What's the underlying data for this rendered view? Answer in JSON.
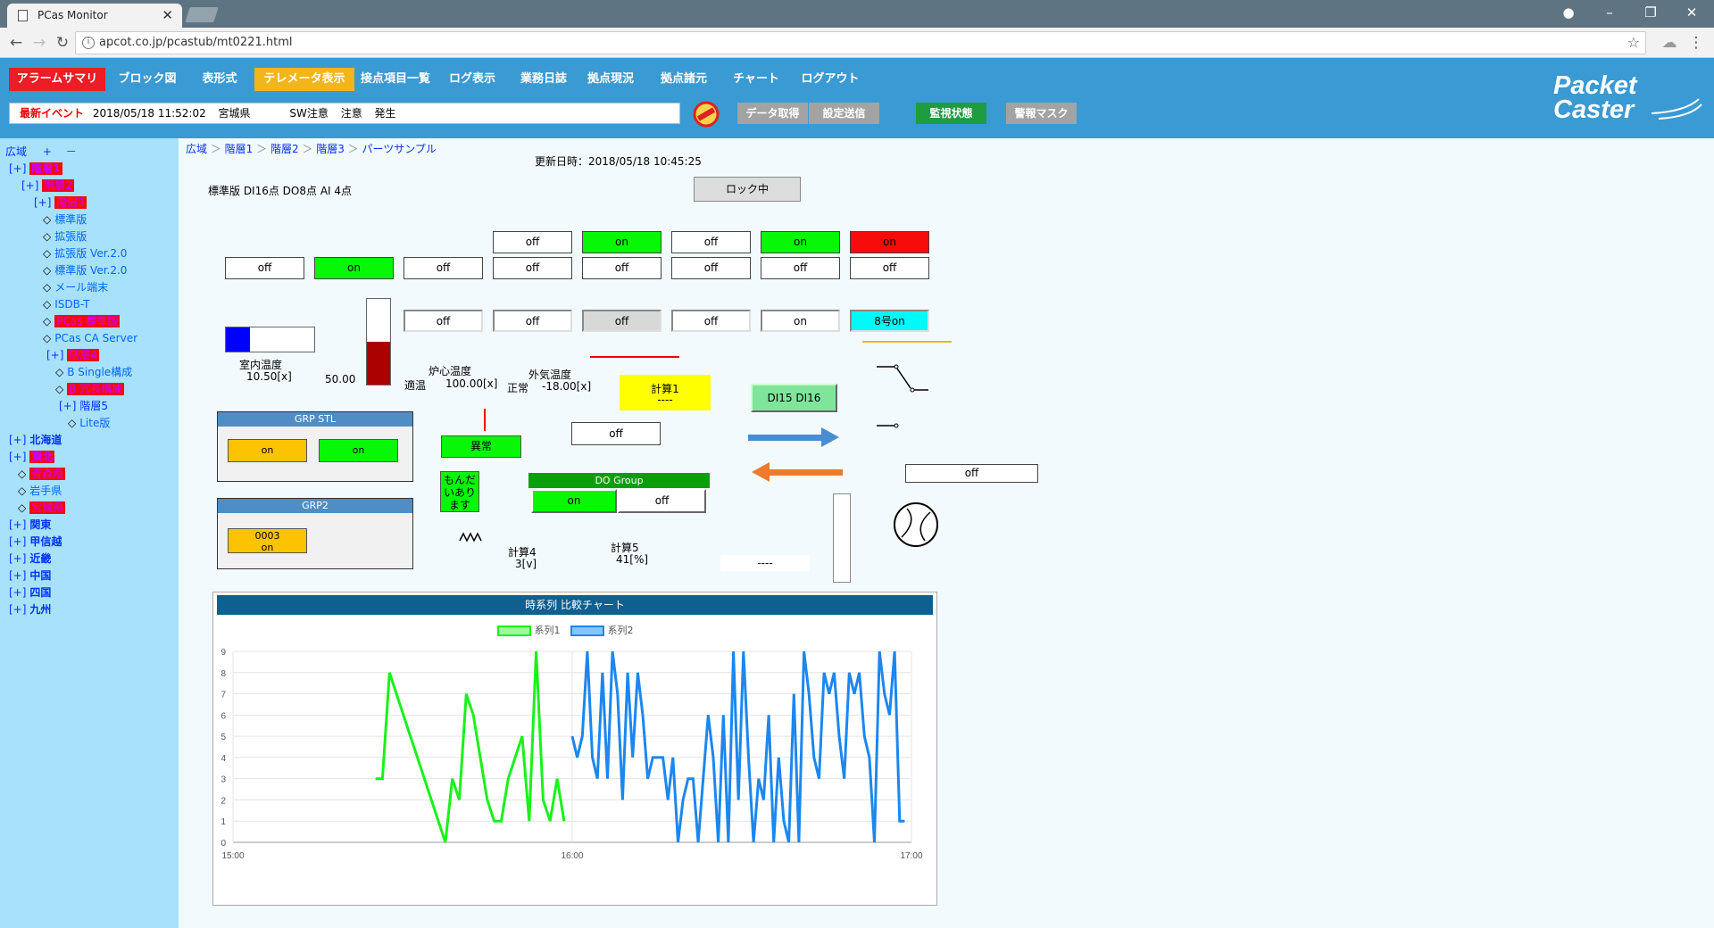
{
  "browser": {
    "tab_title": "PCas Monitor",
    "url": "apcot.co.jp/pcastub/mt0221.html"
  },
  "menu": {
    "items": [
      "アラームサマリ",
      "ブロック図",
      "表形式",
      "テレメータ表示",
      "接点項目一覧",
      "ログ表示",
      "業務日誌",
      "拠点現況",
      "拠点諸元",
      "チャート",
      "ログアウト"
    ]
  },
  "event": {
    "label": "最新イベント",
    "time": "2018/05/18 11:52:02",
    "place": "宮城県",
    "type": "SW注意",
    "level": "注意",
    "state": "発生"
  },
  "actions": [
    "データ取得",
    "設定送信",
    "監視状態",
    "警報マスク"
  ],
  "logo": {
    "line1": "Packet",
    "line2": "Caster"
  },
  "tree": {
    "root": "広域",
    "plus": "+",
    "minus": "－",
    "toggle": "[+]",
    "nodes": [
      {
        "label": "階層1",
        "highlight": true
      },
      {
        "label": "階層2",
        "highlight": true
      },
      {
        "label": "階層3",
        "highlight": true
      },
      {
        "label": "標準版"
      },
      {
        "label": "拡張版"
      },
      {
        "label": "拡張版 Ver.2.0"
      },
      {
        "label": "標準版 Ver.2.0"
      },
      {
        "label": "メール端末"
      },
      {
        "label": "ISDB-T"
      },
      {
        "label": "PCas 標準版",
        "highlight": true
      },
      {
        "label": "PCas CA Server"
      },
      {
        "label": "階層4",
        "highlight": true
      },
      {
        "label": "B Single構成"
      },
      {
        "label": "B 冗長構成",
        "highlight": true
      },
      {
        "label": "階層5"
      },
      {
        "label": "Lite版"
      },
      {
        "label": "北海道"
      },
      {
        "label": "東北",
        "highlight": true
      },
      {
        "label": "青森県",
        "highlight": true
      },
      {
        "label": "岩手県"
      },
      {
        "label": "宮城県",
        "highlight": true
      },
      {
        "label": "関東"
      },
      {
        "label": "甲信越"
      },
      {
        "label": "近畿"
      },
      {
        "label": "中国"
      },
      {
        "label": "四国"
      },
      {
        "label": "九州"
      }
    ]
  },
  "breadcrumb": [
    "広域",
    "階層1",
    "階層2",
    "階層3",
    "パーツサンプル"
  ],
  "updated": "更新日時：2018/05/18 10:45:25",
  "device_info": "標準版 DI16点 DO8点 AI 4点",
  "lock_button": "ロック中",
  "switches": {
    "row1": [
      "off",
      "on",
      "off",
      "on",
      "on"
    ],
    "row2": [
      "off",
      "on",
      "off",
      "off",
      "off",
      "off",
      "off",
      "off"
    ],
    "row3": [
      "off",
      "off",
      "off",
      "off",
      "on",
      "8号on"
    ]
  },
  "gauges": {
    "room_temp": {
      "label": "室内温度",
      "value": "10.50[x]",
      "fill": 0.27
    },
    "vertical": {
      "value": "50.00",
      "fill": 0.5
    },
    "core_temp": {
      "label": "炉心温度",
      "state": "適温",
      "value": "100.00[x]"
    },
    "outside_temp": {
      "label": "外気温度",
      "state": "正常",
      "value": "-18.00[x]"
    }
  },
  "calc": {
    "calc1": {
      "label": "計算1",
      "value": "----"
    },
    "calc4": {
      "label": "計算4",
      "value": "3[v]"
    },
    "calc5": {
      "label": "計算5",
      "value": "41[%]"
    },
    "dash": "----"
  },
  "di_button": "DI15 DI16",
  "grp_stl": {
    "title": "GRP STL",
    "buttons": [
      "on",
      "on"
    ]
  },
  "grp2": {
    "title": "GRP2",
    "value": "0003",
    "state": "on"
  },
  "abnormal": "異常",
  "problem": "もんだいあります",
  "do_group": {
    "title": "DO Group",
    "on": "on",
    "off": "off"
  },
  "off_single": "off",
  "off_wide": "off",
  "colors": {
    "menu_red": "#ee1c24",
    "menu_yellow": "#f2b619",
    "green": "#07f707",
    "header": "#3a9ad3"
  },
  "chart_data": {
    "type": "line",
    "title": "時系列 比較チャート",
    "x_ticks": [
      "15:00",
      "16:00",
      "17:00"
    ],
    "ylim": [
      0,
      9
    ],
    "y_ticks": [
      0,
      1,
      2,
      3,
      4,
      5,
      6,
      7,
      8,
      9
    ],
    "series": [
      {
        "name": "系列1",
        "color": "#19f219",
        "values": [
          3,
          3,
          8,
          7,
          6,
          5,
          4,
          3,
          2,
          1,
          0,
          3,
          2,
          7,
          6,
          4,
          2,
          1,
          1,
          3,
          4,
          5,
          1,
          9,
          2,
          1,
          3,
          1
        ]
      },
      {
        "name": "系列2",
        "color": "#1b87ef",
        "values": [
          5,
          4,
          5,
          9,
          4,
          3,
          8,
          3,
          9,
          7,
          2,
          8,
          4,
          8,
          6,
          3,
          4,
          4,
          4,
          2,
          4,
          0,
          2,
          3,
          3,
          0,
          3,
          6,
          4,
          0,
          6,
          0,
          9,
          2,
          9,
          4,
          0,
          3,
          2,
          6,
          0,
          4,
          1,
          0,
          7,
          0,
          9,
          7,
          4,
          3,
          8,
          7,
          8,
          5,
          3,
          8,
          7,
          8,
          5,
          4,
          0,
          9,
          7,
          6,
          9,
          1,
          1
        ]
      }
    ]
  }
}
